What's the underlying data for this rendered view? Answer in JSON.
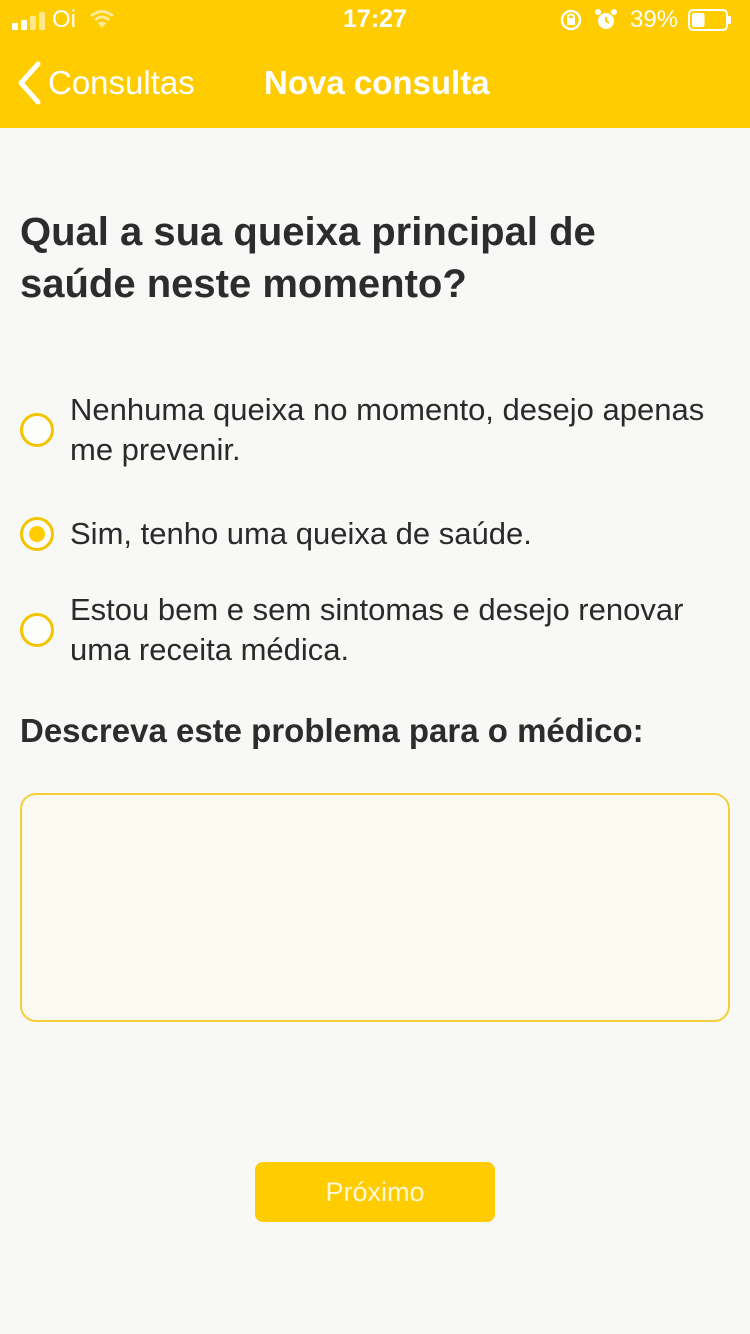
{
  "status_bar": {
    "carrier": "Oi",
    "time": "17:27",
    "battery_percent": "39%",
    "battery_level": 0.39,
    "icons": [
      "signal-icon",
      "wifi-icon",
      "rotation-lock-icon",
      "alarm-icon",
      "battery-icon"
    ]
  },
  "nav": {
    "back_label": "Consultas",
    "title": "Nova consulta",
    "back_icon": "chevron-left-icon"
  },
  "question": {
    "text": "Qual a sua queixa principal de saúde neste momento?"
  },
  "options": [
    {
      "label": "Nenhuma queixa no momento, desejo apenas me prevenir.",
      "selected": false
    },
    {
      "label": "Sim, tenho uma queixa de saúde.",
      "selected": true
    },
    {
      "label": "Estou bem e sem sintomas e desejo renovar uma receita médica.",
      "selected": false
    }
  ],
  "description": {
    "label": "Descreva este problema para o médico:",
    "value": "",
    "placeholder": ""
  },
  "next_button": {
    "label": "Próximo"
  },
  "colors": {
    "accent": "#ffcc00",
    "background": "#f8f8f6",
    "textarea_bg": "#fcf9f0"
  }
}
